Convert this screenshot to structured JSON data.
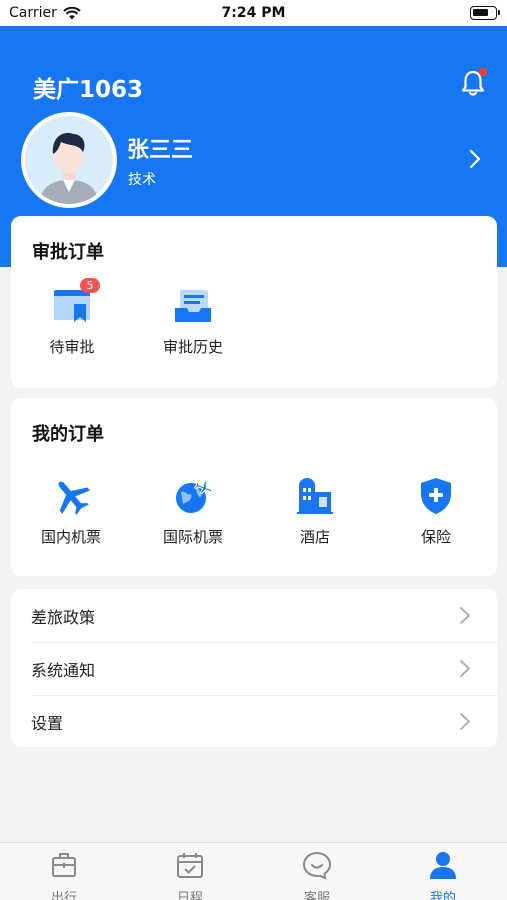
{
  "status_bar": {
    "carrier": "Carrier",
    "time": "7:24 PM"
  },
  "header": {
    "app_title": "美广1063",
    "user": {
      "name": "张三三",
      "role": "技术"
    }
  },
  "approval_orders": {
    "title": "审批订单",
    "items": [
      {
        "label": "待审批",
        "icon": "pending-approval-icon",
        "badge": "5"
      },
      {
        "label": "审批历史",
        "icon": "approval-history-icon"
      }
    ]
  },
  "my_orders": {
    "title": "我的订单",
    "items": [
      {
        "label": "国内机票",
        "icon": "domestic-flight-icon"
      },
      {
        "label": "国际机票",
        "icon": "international-flight-icon"
      },
      {
        "label": "酒店",
        "icon": "hotel-icon"
      },
      {
        "label": "保险",
        "icon": "insurance-icon"
      }
    ]
  },
  "menu": [
    {
      "label": "差旅政策"
    },
    {
      "label": "系统通知"
    },
    {
      "label": "设置"
    }
  ],
  "tabbar": [
    {
      "label": "出行",
      "icon": "travel-icon",
      "active": false
    },
    {
      "label": "日程",
      "icon": "calendar-icon",
      "active": false
    },
    {
      "label": "客服",
      "icon": "customer-service-icon",
      "active": false
    },
    {
      "label": "我的",
      "icon": "profile-icon",
      "active": true
    }
  ],
  "colors": {
    "brand": "#1777f2",
    "badge": "#f05454",
    "background": "#f2f3f5"
  }
}
